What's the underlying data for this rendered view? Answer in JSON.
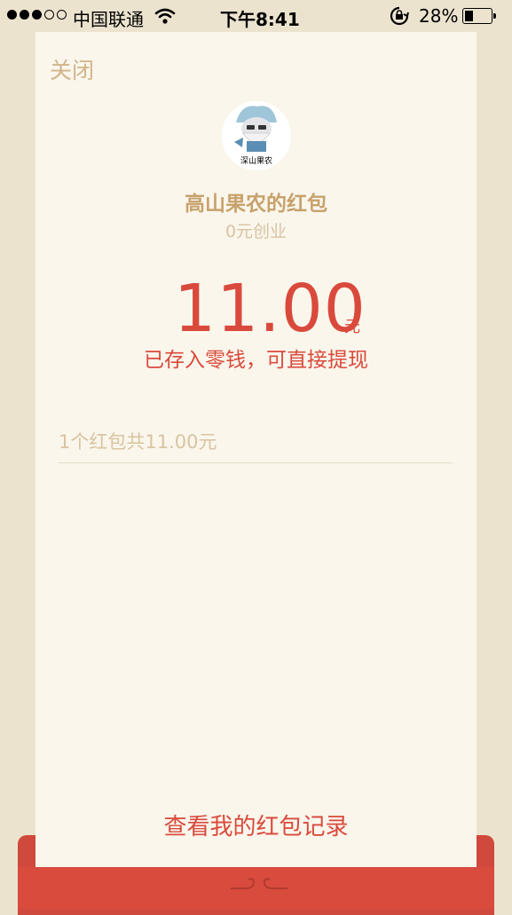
{
  "status_bar": {
    "carrier": "中国联通",
    "time": "下午8:41",
    "battery_percent": "28%",
    "signal_bars_filled": 3,
    "signal_bars_total": 5
  },
  "header": {
    "close_label": "关闭"
  },
  "sender": {
    "avatar_caption": "深山果农",
    "title": "高山果农的红包",
    "greeting": "0元创业"
  },
  "amount": {
    "value": "11.00",
    "unit": "元",
    "note": "已存入零钱，可直接提现"
  },
  "summary": {
    "text": "1个红包共11.00元"
  },
  "footer": {
    "records_link": "查看我的红包记录"
  },
  "colors": {
    "background": "#ece3cf",
    "card": "#faf6ec",
    "accent_red": "#d94a3c",
    "title_gold": "#c7a26c",
    "muted": "#d8c4a0"
  }
}
